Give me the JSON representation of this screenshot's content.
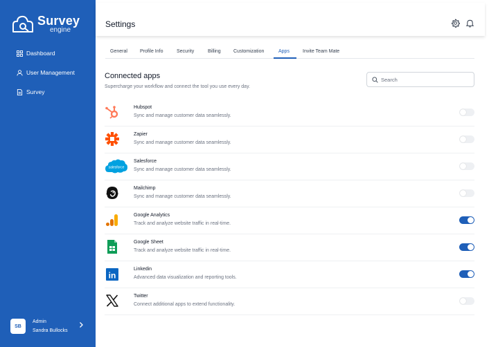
{
  "sidebar": {
    "logo": {
      "main": "Survey",
      "sub": "engine"
    },
    "items": [
      {
        "label": "Dashboard",
        "icon": "grid-icon"
      },
      {
        "label": "User Management",
        "icon": "user-icon"
      },
      {
        "label": "Survey",
        "icon": "document-icon"
      }
    ],
    "user": {
      "initials": "SB",
      "role": "Admin",
      "name": "Sandra Bullocks"
    }
  },
  "header": {
    "title": "Settings",
    "icons": [
      "gear-icon",
      "bell-icon"
    ]
  },
  "tabs": [
    {
      "label": "General"
    },
    {
      "label": "Profile Info"
    },
    {
      "label": "Security"
    },
    {
      "label": "Billing"
    },
    {
      "label": "Customization"
    },
    {
      "label": "Apps",
      "active": true
    },
    {
      "label": "Invite Team Mate"
    }
  ],
  "section": {
    "title": "Connected apps",
    "subtitle": "Supercharge your workflow and connect the tool you use every day.",
    "search_placeholder": "Search"
  },
  "apps": [
    {
      "name": "Hubspot",
      "description": "Sync and manage customer data seamlessly.",
      "enabled": false,
      "icon": "hubspot-icon"
    },
    {
      "name": "Zapier",
      "description": "Sync and manage customer data seamlessly.",
      "enabled": false,
      "icon": "zapier-icon"
    },
    {
      "name": "Salesforce",
      "description": "Sync and manage customer data seamlessly.",
      "enabled": false,
      "icon": "salesforce-icon",
      "icon_text": "salesforce"
    },
    {
      "name": "Mailchimp",
      "description": "Sync and manage customer data seamlessly.",
      "enabled": false,
      "icon": "mailchimp-icon"
    },
    {
      "name": "Google Analytics",
      "description": "Track and analyze website traffic in real-time.",
      "enabled": true,
      "icon": "google-analytics-icon"
    },
    {
      "name": "Google Sheet",
      "description": "Track and analyze website traffic in real-time.",
      "enabled": true,
      "icon": "google-sheets-icon"
    },
    {
      "name": "Linkedin",
      "description": "Advanced data visualization and reporting tools.",
      "enabled": true,
      "icon": "linkedin-icon",
      "icon_text": "in"
    },
    {
      "name": "Twitter",
      "description": "Connect additional apps to extend functionality.",
      "enabled": false,
      "icon": "x-twitter-icon"
    }
  ],
  "colors": {
    "brand": "#1f5fb8",
    "toggle_off": "#eef0f3",
    "hubspot": "#ff7a59",
    "zapier": "#ff4f00",
    "salesforce": "#00a1e0",
    "analytics_orange": "#f9ab00",
    "sheets_green": "#0f9d58",
    "linkedin": "#0a66c2"
  }
}
